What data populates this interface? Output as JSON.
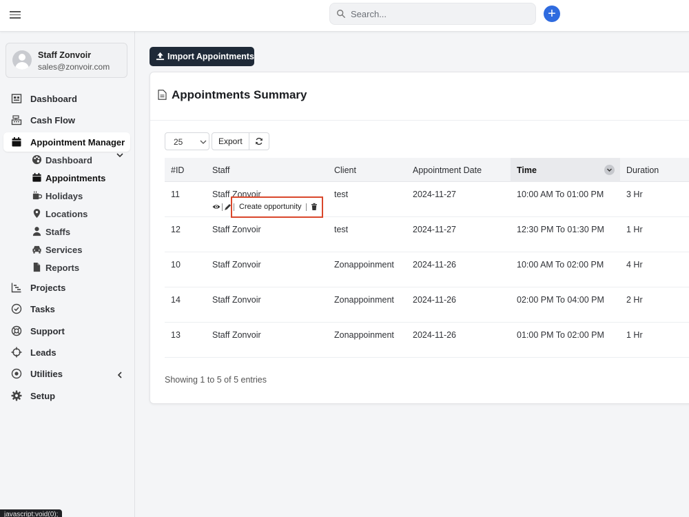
{
  "topbar": {
    "search_placeholder": "Search..."
  },
  "user": {
    "name": "Staff Zonvoir",
    "email": "sales@zonvoir.com"
  },
  "sidebar": {
    "items": [
      {
        "label": "Dashboard",
        "icon": "dashboard-icon"
      },
      {
        "label": "Cash Flow",
        "icon": "cash-register-icon"
      },
      {
        "label": "Appointment Manager",
        "icon": "calendar-icon"
      },
      {
        "label": "Projects",
        "icon": "chart-bars-icon"
      },
      {
        "label": "Tasks",
        "icon": "check-circle-icon"
      },
      {
        "label": "Support",
        "icon": "lifebuoy-icon"
      },
      {
        "label": "Leads",
        "icon": "crosshair-icon"
      },
      {
        "label": "Utilities",
        "icon": "dot-circle-icon"
      },
      {
        "label": "Setup",
        "icon": "gear-icon"
      }
    ],
    "sub_items": [
      {
        "label": "Dashboard",
        "icon": "palette-icon"
      },
      {
        "label": "Appointments",
        "icon": "calendar-icon"
      },
      {
        "label": "Holidays",
        "icon": "mug-icon"
      },
      {
        "label": "Locations",
        "icon": "map-pin-icon"
      },
      {
        "label": "Staffs",
        "icon": "user-icon"
      },
      {
        "label": "Services",
        "icon": "car-icon"
      },
      {
        "label": "Reports",
        "icon": "file-icon"
      }
    ]
  },
  "main": {
    "import_label": "Import Appointments",
    "panel_title": "Appointments Summary",
    "page_size": "25",
    "export_label": "Export",
    "columns": [
      "#ID",
      "Staff",
      "Client",
      "Appointment Date",
      "Time",
      "Duration"
    ],
    "rows": [
      {
        "id": "11",
        "staff": "Staff Zonvoir",
        "client": "test",
        "date": "2024-11-27",
        "time": "10:00 AM To 01:00 PM",
        "duration": "3 Hr"
      },
      {
        "id": "12",
        "staff": "Staff Zonvoir",
        "client": "test",
        "date": "2024-11-27",
        "time": "12:30 PM To 01:30 PM",
        "duration": "1 Hr"
      },
      {
        "id": "10",
        "staff": "Staff Zonvoir",
        "client": "Zonappoinment",
        "date": "2024-11-26",
        "time": "10:00 AM To 02:00 PM",
        "duration": "4 Hr"
      },
      {
        "id": "14",
        "staff": "Staff Zonvoir",
        "client": "Zonappoinment",
        "date": "2024-11-26",
        "time": "02:00 PM To 04:00 PM",
        "duration": "2 Hr"
      },
      {
        "id": "13",
        "staff": "Staff Zonvoir",
        "client": "Zonappoinment",
        "date": "2024-11-26",
        "time": "01:00 PM To 02:00 PM",
        "duration": "1 Hr"
      }
    ],
    "row_action_label": "Create opportunity",
    "showing": "Showing 1 to 5 of 5 entries"
  },
  "status_bar": "javascript:void(0);",
  "colors": {
    "accent": "#2f6bdf",
    "import_button": "#1f2a38",
    "highlight_box": "#d9472b"
  }
}
